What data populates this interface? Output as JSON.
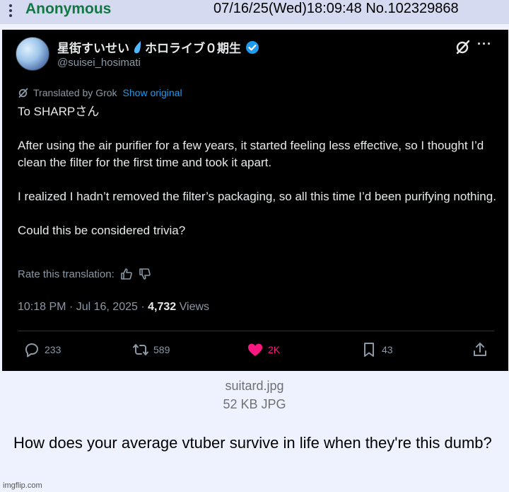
{
  "post": {
    "name": "Anonymous",
    "datetime": "07/16/25(Wed)18:09:48",
    "post_number": "No.102329868"
  },
  "tweet": {
    "display_name_prefix": "星街すいせい",
    "display_name_suffix": "ホロライブ０期生",
    "handle": "@suisei_hosimati",
    "translated_by": "Translated by Grok",
    "show_original": "Show original",
    "paragraphs": [
      "To SHARPさん",
      "After using the air purifier for a few years, it started feeling less effective, so I thought I’d clean the filter for the first time and took it apart.",
      "I realized I hadn’t removed the filter’s packaging, so all this time I’d been purifying nothing.",
      "Could this be considered trivia?"
    ],
    "rate_translation": "Rate this translation:",
    "time": "10:18 PM",
    "date": "Jul 16, 2025",
    "views_count": "4,732",
    "views_label": "Views",
    "replies": "233",
    "reposts": "589",
    "likes": "2K",
    "bookmarks": "43",
    "colors": {
      "like": "#f91880",
      "link": "#1d9bf0",
      "verified": "#1d9bf0"
    }
  },
  "file": {
    "name": "suitard.jpg",
    "info": "52 KB JPG"
  },
  "comment": "How does your average vtuber survive in life when they're this dumb?",
  "watermark": "imgflip.com"
}
